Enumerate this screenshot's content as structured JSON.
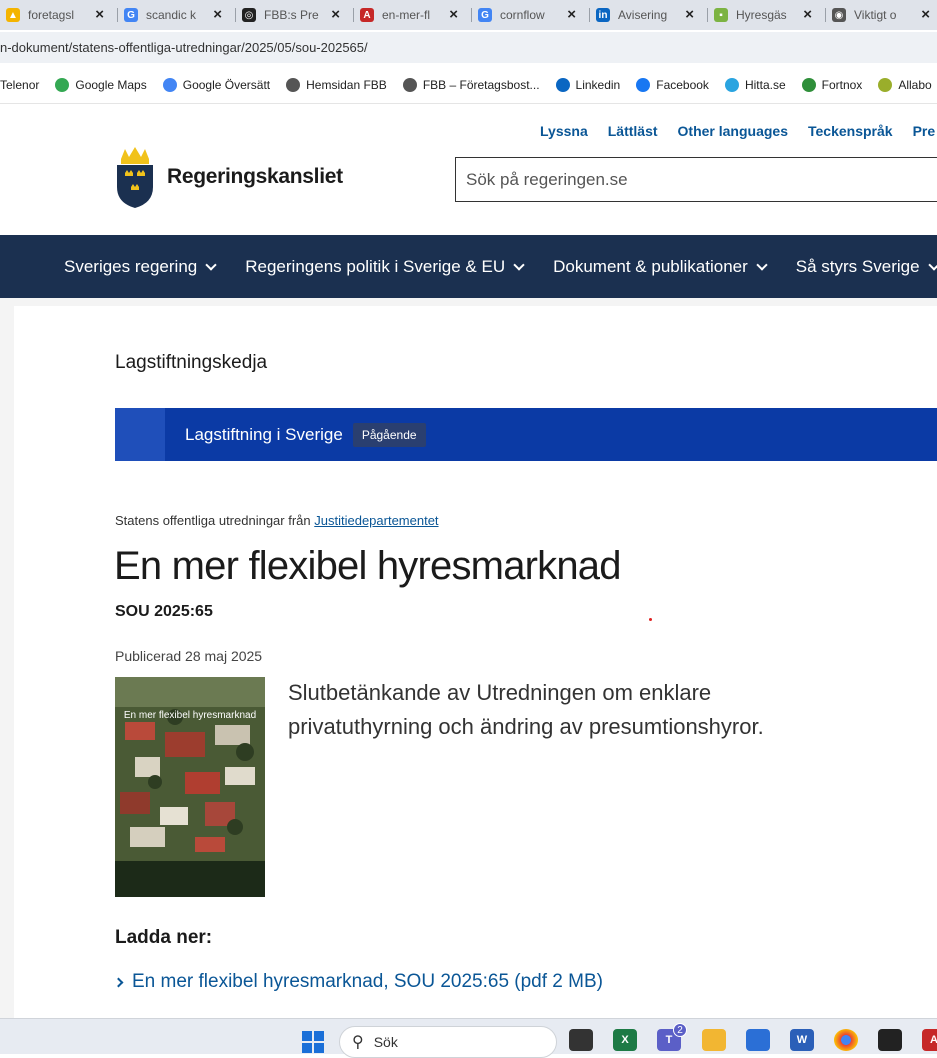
{
  "browser": {
    "tabs": [
      {
        "title": "foretagsl",
        "icon": "drive-icon",
        "color": "#f4b400",
        "glyph": "▲"
      },
      {
        "title": "scandic k",
        "icon": "google-icon",
        "color": "#4285f4",
        "glyph": "G"
      },
      {
        "title": "FBB:s Pre",
        "icon": "chatgpt-icon",
        "color": "#222222",
        "glyph": "◎"
      },
      {
        "title": "en-mer-fl",
        "icon": "pdf-icon",
        "color": "#c62828",
        "glyph": "A"
      },
      {
        "title": "cornflow",
        "icon": "google-icon",
        "color": "#4285f4",
        "glyph": "G"
      },
      {
        "title": "Avisering",
        "icon": "linkedin-icon",
        "color": "#0a66c2",
        "glyph": "in"
      },
      {
        "title": "Hyresgäs",
        "icon": "dots-icon",
        "color": "#7cb342",
        "glyph": "▪"
      },
      {
        "title": "Viktigt o",
        "icon": "globe-icon",
        "color": "#555555",
        "glyph": "◉"
      }
    ],
    "url": "n-dokument/statens-offentliga-utredningar/2025/05/sou-202565/",
    "bookmarks": [
      {
        "label": "Telenor",
        "icon": "telenor-icon",
        "color": "#1a73e8"
      },
      {
        "label": "Google Maps",
        "icon": "maps-icon",
        "color": "#34a853"
      },
      {
        "label": "Google Översätt",
        "icon": "translate-icon",
        "color": "#4285f4"
      },
      {
        "label": "Hemsidan FBB",
        "icon": "globe-icon",
        "color": "#555555"
      },
      {
        "label": "FBB – Företagsbost...",
        "icon": "globe-icon",
        "color": "#555555"
      },
      {
        "label": "Linkedin",
        "icon": "linkedin-icon",
        "color": "#0a66c2"
      },
      {
        "label": "Facebook",
        "icon": "facebook-icon",
        "color": "#1877f2"
      },
      {
        "label": "Hitta.se",
        "icon": "hitta-icon",
        "color": "#2aa4e0"
      },
      {
        "label": "Fortnox",
        "icon": "fortnox-icon",
        "color": "#2f8f3a"
      },
      {
        "label": "Allabo",
        "icon": "allabo-icon",
        "color": "#9aae2b"
      }
    ]
  },
  "header": {
    "toplinks": [
      "Lyssna",
      "Lättläst",
      "Other languages",
      "Teckenspråk",
      "Pre"
    ],
    "logo_text": "Regeringskansliet",
    "search_placeholder": "Sök på regeringen.se"
  },
  "nav": {
    "items": [
      "Sveriges regering",
      "Regeringens politik i Sverige & EU",
      "Dokument & publikationer",
      "Så styrs Sverige"
    ]
  },
  "page": {
    "chain_title": "Lagstiftningskedja",
    "chain_label": "Lagstiftning i Sverige",
    "chain_badge": "Pågående",
    "meta_prefix": "Statens offentliga utredningar från",
    "meta_link": "Justitiedepartementet",
    "title": "En mer flexibel hyresmarknad",
    "sou": "SOU 2025:65",
    "published": "Publicerad 28 maj 2025",
    "cover_title": "En mer flexibel hyresmarknad",
    "lead": "Slutbetänkande av Utredningen om enklare privatuthyrning och ändring av presumtionshyror.",
    "download_title": "Ladda ner:",
    "download_link": "En mer flexibel hyresmarknad, SOU 2025:65 (pdf 2 MB)"
  },
  "taskbar": {
    "search_label": "Sök",
    "teams_badge": "2"
  }
}
